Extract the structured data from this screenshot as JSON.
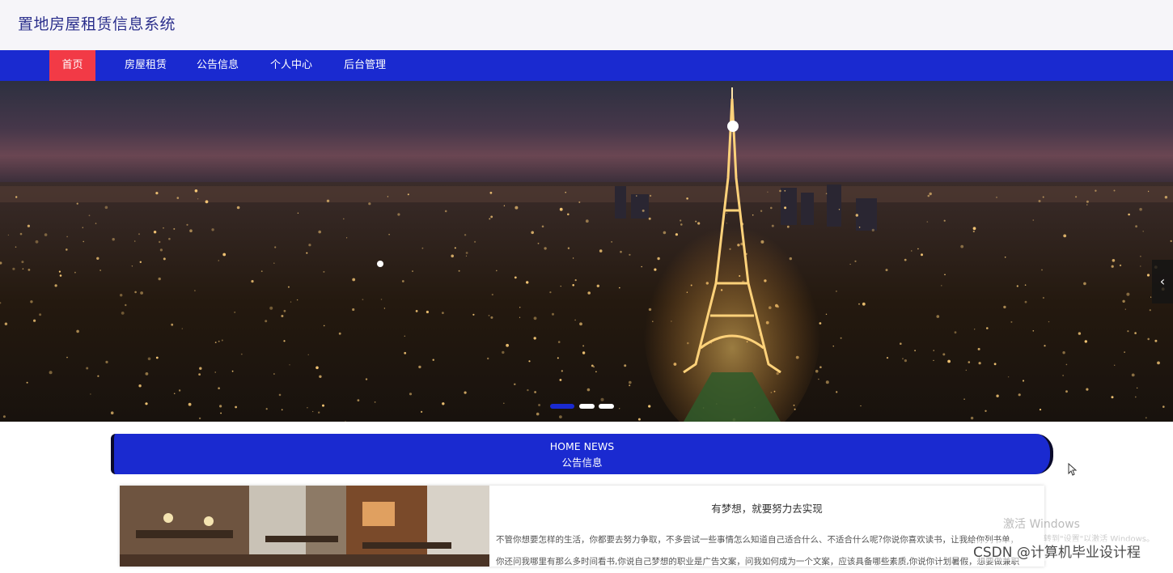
{
  "header": {
    "title": "置地房屋租赁信息系统"
  },
  "nav": {
    "items": [
      {
        "label": "首页",
        "active": true
      },
      {
        "label": "房屋租赁"
      },
      {
        "label": "公告信息"
      },
      {
        "label": "个人中心"
      },
      {
        "label": "后台管理"
      }
    ]
  },
  "banner": {
    "image": "night-city-eiffel-tower",
    "slide_count": 3,
    "active_slide": 1,
    "prev_icon": "chevron-left-icon"
  },
  "news": {
    "heading_en": "HOME NEWS",
    "heading_cn": "公告信息"
  },
  "news_card": {
    "image": "hotel-dining-room",
    "title": "有梦想，就要努力去实现",
    "text_lines": [
      "不管你想要怎样的生活，你都要去努力争取，不多尝试一些事情怎么知道自己适合什么、不适合什么呢?你说你喜欢读书，让我给你列书单，",
      "你还问我哪里有那么多时间看书,你说自己梦想的职业是广告文案，问我如何成为一个文案，应该具备哪些素质,你说你计划暑假，想要做兼职"
    ]
  },
  "watermarks": {
    "activate": "激活 Windows",
    "activate_sub": "转到\"设置\"以激活 Windows。",
    "source": "CSDN @计算机毕业设计程"
  },
  "colors": {
    "primary": "#1a2ad0",
    "active": "#f23a46",
    "title": "#2b2f8c"
  }
}
